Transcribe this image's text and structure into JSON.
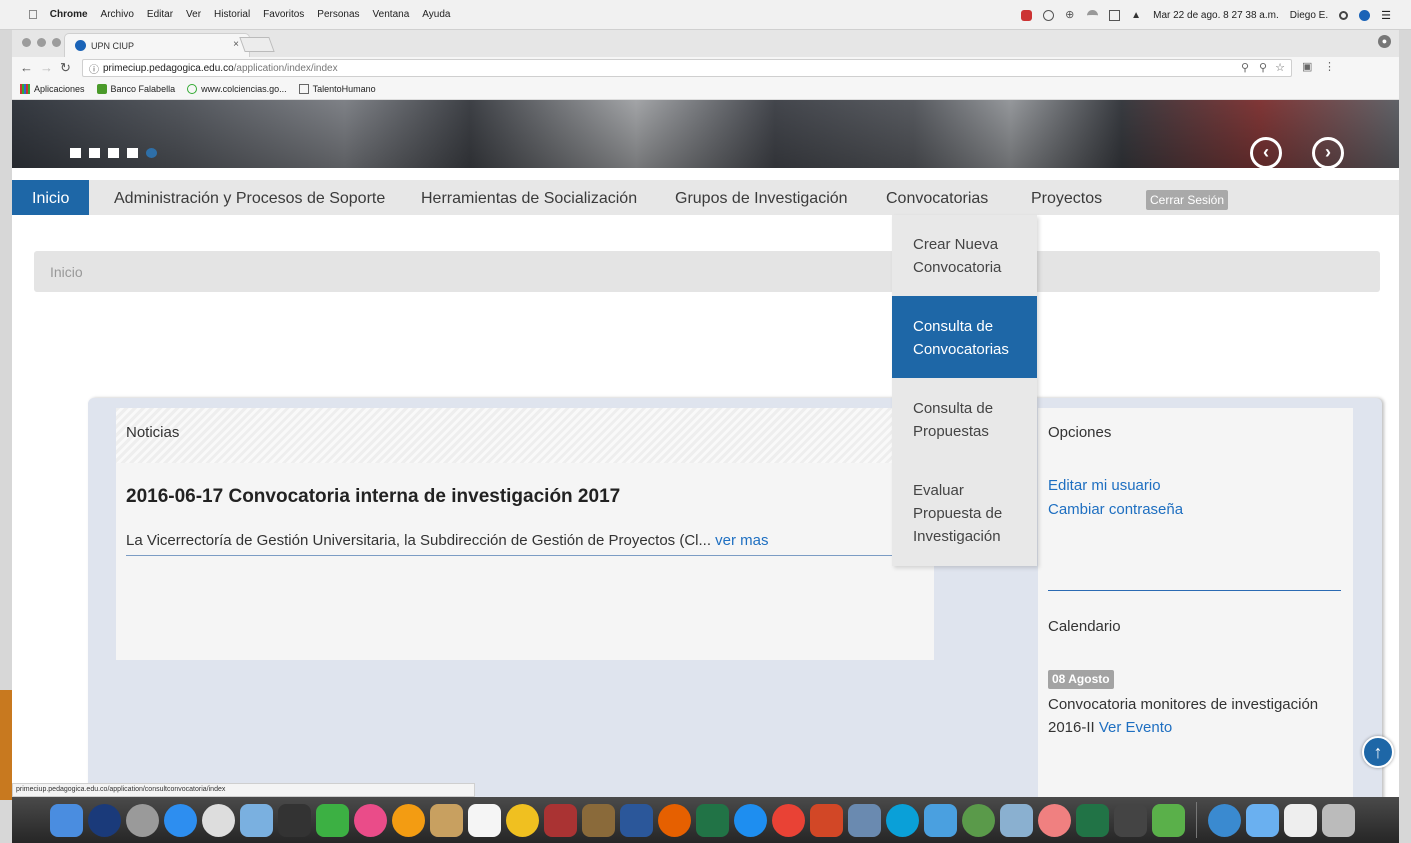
{
  "menubar": {
    "app": "Chrome",
    "items": [
      "Archivo",
      "Editar",
      "Ver",
      "Historial",
      "Favoritos",
      "Personas",
      "Ventana",
      "Ayuda"
    ],
    "clock": "Mar 22 de ago.  8 27 38 a.m.",
    "user": "Diego E."
  },
  "browser": {
    "tab_title": "UPN CIUP",
    "tab_close": "×",
    "url_host": "primeciup.pedagogica.edu.co",
    "url_path": "/application/index/index",
    "bookmarks": [
      "Aplicaciones",
      "Banco Falabella",
      "www.colciencias.go...",
      "TalentoHumano"
    ],
    "status_url": "primeciup.pedagogica.edu.co/application/consultconvocatoria/index"
  },
  "nav": {
    "items": [
      "Inicio",
      "Administración y Procesos de Soporte",
      "Herramientas de Socialización",
      "Grupos de Investigación",
      "Convocatorias",
      "Proyectos"
    ],
    "logout": "Cerrar Sesión"
  },
  "dropdown": {
    "items": [
      {
        "line1": "Crear Nueva",
        "line2": "Convocatoria"
      },
      {
        "line1": "Consulta de",
        "line2": "Convocatorias"
      },
      {
        "line1": "Consulta de",
        "line2": "Propuestas"
      },
      {
        "line1": "Evaluar",
        "line2": "Propuesta de",
        "line3": "Investigación"
      }
    ]
  },
  "breadcrumb": "Inicio",
  "news": {
    "heading": "Noticias",
    "title": "2016-06-17 Convocatoria interna de investigación 2017",
    "excerpt": "La Vicerrectoría de Gestión Universitaria, la Subdirección de Gestión de Proyectos (Cl...",
    "more": "ver mas"
  },
  "sidebar": {
    "options_title": "Opciones",
    "edit_user": "Editar mi usuario",
    "change_password": "Cambiar contraseña",
    "calendar_title": "Calendario",
    "date_badge": "08 Agosto",
    "event_text": "Convocatoria monitores de investigación 2016-II",
    "event_link": "Ver Evento"
  },
  "colors": {
    "accent": "#1e67a7",
    "link": "#1e6fc1"
  }
}
